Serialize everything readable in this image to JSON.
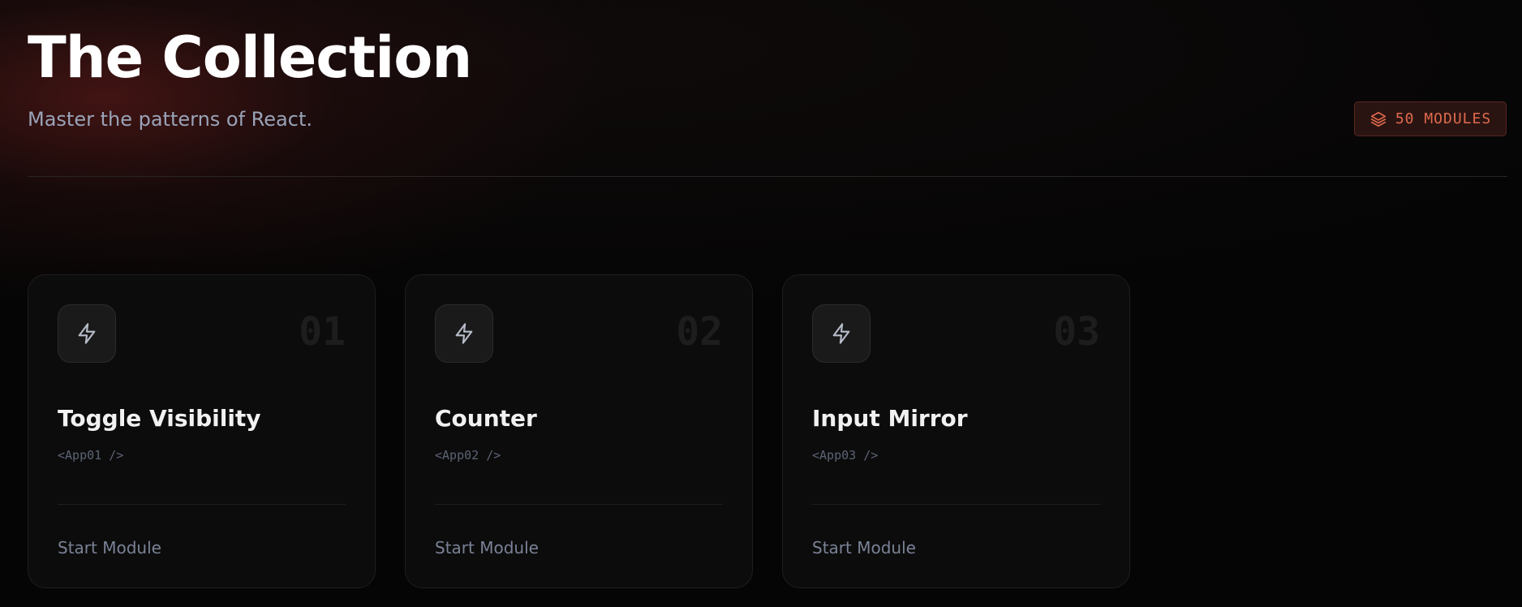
{
  "header": {
    "title": "The Collection",
    "subtitle": "Master the patterns of React."
  },
  "badge": {
    "icon": "layers-icon",
    "label": "50 MODULES",
    "color": "#e06a4d"
  },
  "cards": [
    {
      "icon": "lightning-icon",
      "number": "01",
      "title": "Toggle Visibility",
      "code": "<App01 />",
      "action": "Start Module"
    },
    {
      "icon": "lightning-icon",
      "number": "02",
      "title": "Counter",
      "code": "<App02 />",
      "action": "Start Module"
    },
    {
      "icon": "lightning-icon",
      "number": "03",
      "title": "Input Mirror",
      "code": "<App03 />",
      "action": "Start Module"
    }
  ]
}
